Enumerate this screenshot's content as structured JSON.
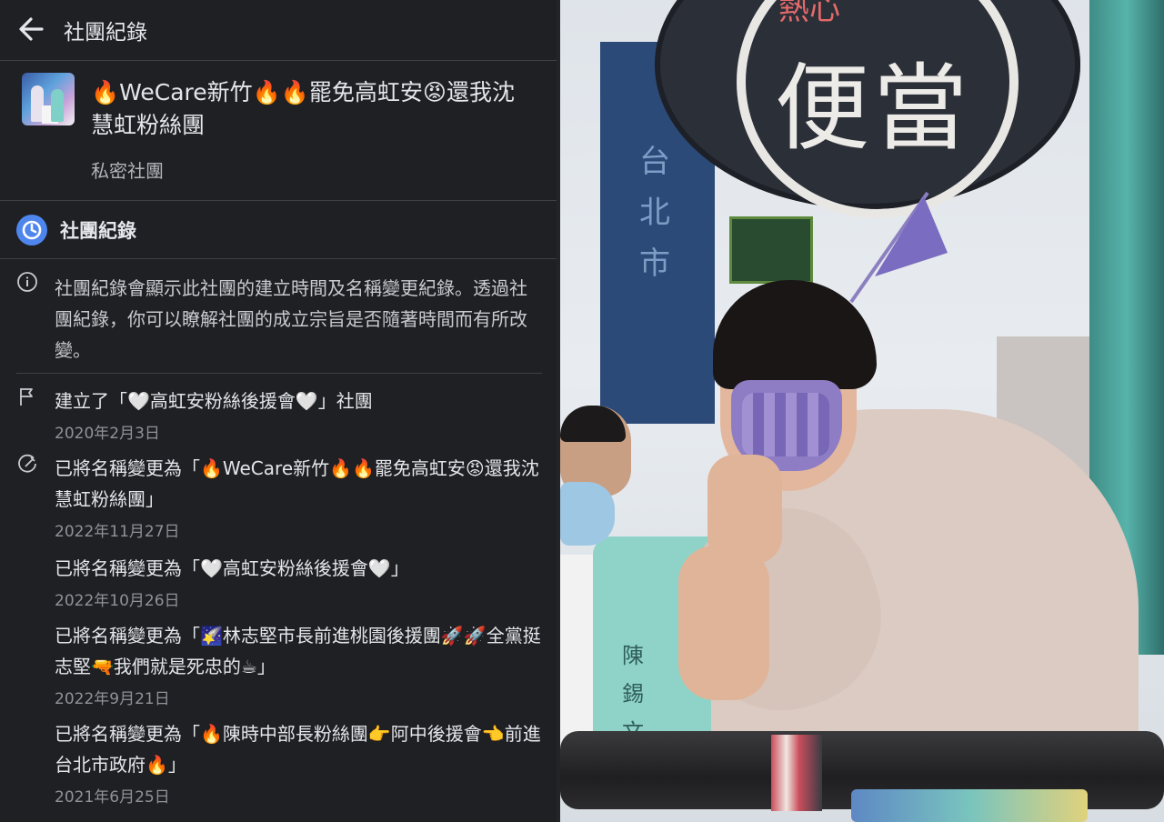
{
  "topbar": {
    "title": "社團紀錄"
  },
  "group": {
    "name": "🔥WeCare新竹🔥🔥罷免高虹安😡還我沈慧虹粉絲團",
    "privacy": "私密社團"
  },
  "section": {
    "title": "社團紀錄"
  },
  "info": {
    "text": "社團紀錄會顯示此社團的建立時間及名稱變更紀錄。透過社團紀錄，你可以瞭解社團的成立宗旨是否隨著時間而有所改變。"
  },
  "entries": [
    {
      "icon": "flag-icon",
      "text": "建立了「🤍高虹安粉絲後援會🤍」社團",
      "date": "2020年2月3日"
    },
    {
      "icon": "rename-icon",
      "text": "已將名稱變更為「🔥WeCare新竹🔥🔥罷免高虹安😡還我沈慧虹粉絲團」",
      "date": "2022年11月27日"
    },
    {
      "icon": "",
      "text": "已將名稱變更為「🤍高虹安粉絲後援會🤍」",
      "date": "2022年10月26日"
    },
    {
      "icon": "",
      "text": "已將名稱變更為「🌠林志堅市長前進桃園後援團🚀🚀全黨挺志堅🔫我們就是死忠的☕」",
      "date": "2022年9月21日"
    },
    {
      "icon": "",
      "text": "已將名稱變更為「🔥陳時中部長粉絲團👉阿中後援會👈前進台北市政府🔥」",
      "date": "2021年6月25日"
    }
  ],
  "photo": {
    "sign_text": "便當",
    "sign_top": "熱心",
    "banner_text": "台北市",
    "vest_name": "陳錫文"
  },
  "colors": {
    "panel_bg": "#1f2023",
    "accent": "#4e86ee",
    "text": "#e4e6eb",
    "muted": "#8f9298"
  }
}
